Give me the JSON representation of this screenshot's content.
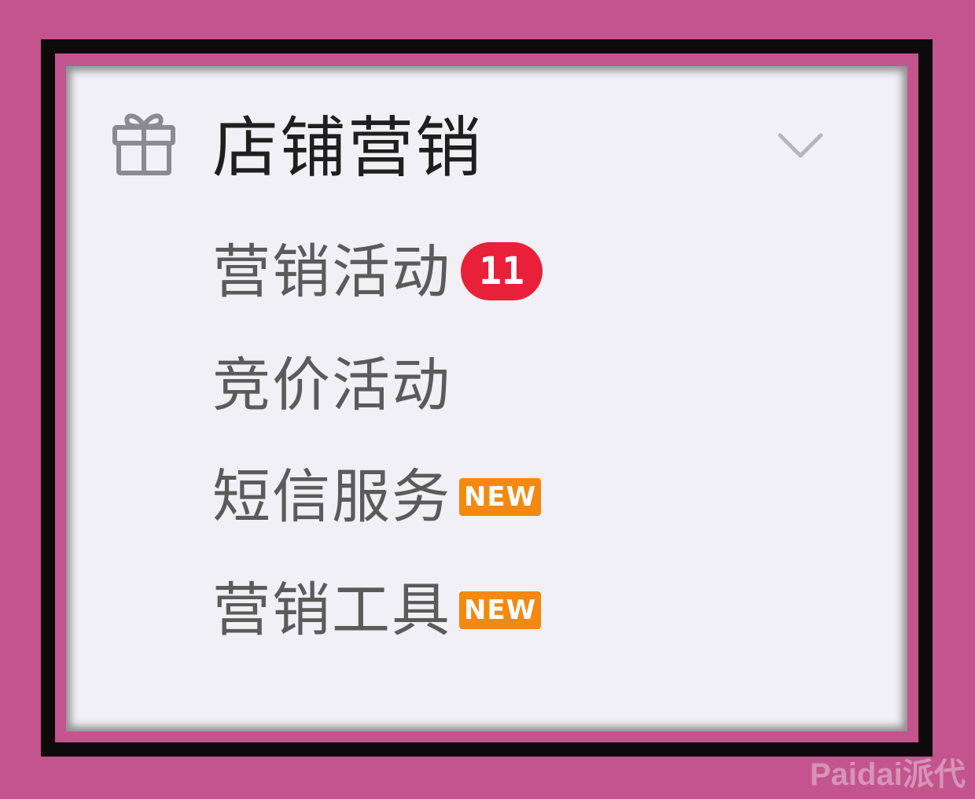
{
  "menu": {
    "header": {
      "label": "店铺营销",
      "icon": "gift-icon",
      "expand_icon": "chevron-down-icon"
    },
    "items": [
      {
        "label": "营销活动",
        "badge": "11",
        "badge_type": "count",
        "badge_color": "#e8203a"
      },
      {
        "label": "竞价活动"
      },
      {
        "label": "短信服务",
        "badge": "NEW",
        "badge_type": "new",
        "badge_color": "#f5880f"
      },
      {
        "label": "营销工具",
        "badge": "NEW",
        "badge_type": "new",
        "badge_color": "#f5880f"
      }
    ]
  },
  "colors": {
    "background": "#c4548e",
    "frame": "#0d0a0c",
    "panel": "#f1f0f4",
    "header_text": "#1f1f1f",
    "item_text": "#5b5b5b"
  },
  "watermark": "Paidai派代"
}
